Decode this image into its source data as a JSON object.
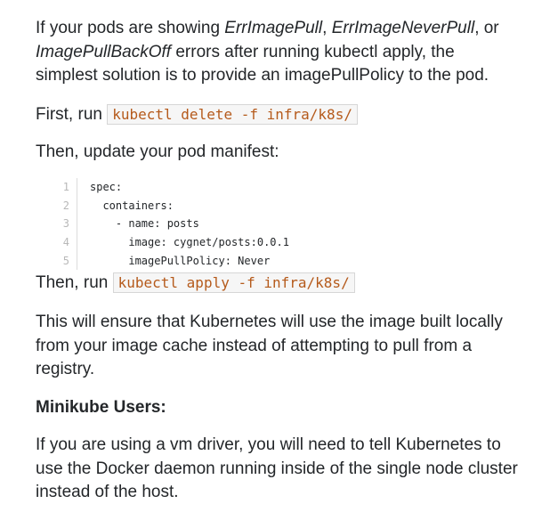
{
  "intro": {
    "t1": "If your pods are showing ",
    "e1": "ErrImagePull",
    "t2": ", ",
    "e2": "ErrImageNeverPull",
    "t3": ", or ",
    "e3": "ImagePullBackOff",
    "t4": " errors after running kubectl apply, the simplest solution is to provide an imagePullPolicy to the pod."
  },
  "step1": {
    "prefix": "First, run ",
    "code": "kubectl delete -f infra/k8s/"
  },
  "step2": {
    "text": "Then, update your pod manifest:"
  },
  "code_lines": [
    {
      "num": "1",
      "text": "spec:"
    },
    {
      "num": "2",
      "text": "  containers:"
    },
    {
      "num": "3",
      "text": "    - name: posts"
    },
    {
      "num": "4",
      "text": "      image: cygnet/posts:0.0.1"
    },
    {
      "num": "5",
      "text": "      imagePullPolicy: Never"
    }
  ],
  "step3": {
    "prefix": "Then, run ",
    "code": "kubectl apply -f infra/k8s/"
  },
  "ensure": "This will ensure that Kubernetes will use the image built locally from your image cache instead of attempting to pull from a registry.",
  "minikube_heading": "Minikube Users:",
  "minikube_text": "If you are using a vm driver, you will need to tell Kubernetes to use the Docker daemon running inside of the single node cluster instead of the host."
}
